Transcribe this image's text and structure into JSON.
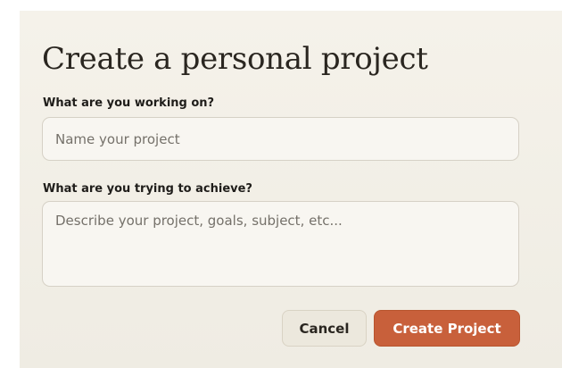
{
  "dialog": {
    "title": "Create a personal project",
    "project_name": {
      "label": "What are you working on?",
      "placeholder": "Name your project",
      "value": ""
    },
    "project_goal": {
      "label": "What are you trying to achieve?",
      "placeholder": "Describe your project, goals, subject, etc...",
      "value": ""
    },
    "buttons": {
      "cancel": "Cancel",
      "create": "Create Project"
    }
  },
  "colors": {
    "background": "#f2efe7",
    "primary_button": "#c8603b",
    "secondary_button": "#ece8dd",
    "text": "#2a2620"
  }
}
